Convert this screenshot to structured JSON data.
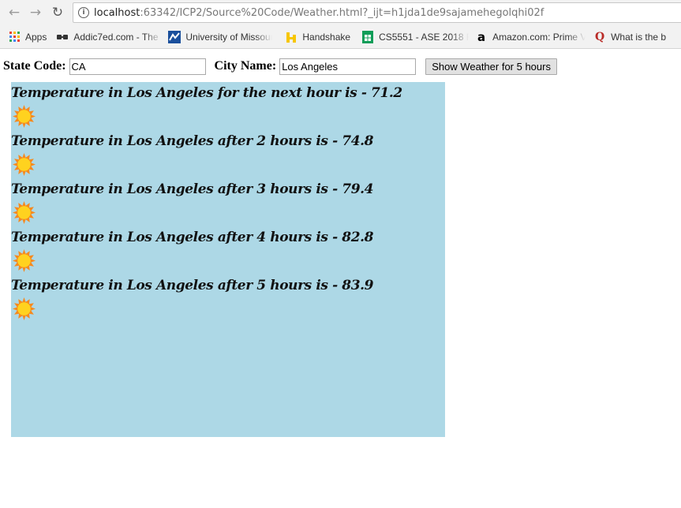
{
  "browser": {
    "url_host": "localhost",
    "url_path": ":63342/ICP2/Source%20Code/Weather.html?_ijt=h1jda1de9sajamehegolqhi02f"
  },
  "bookmarks": [
    {
      "label": "Apps",
      "icon": "apps-grid-icon"
    },
    {
      "label": "Addic7ed.com - The",
      "icon": "addic7ed-icon"
    },
    {
      "label": "University of Missour",
      "icon": "university-icon"
    },
    {
      "label": "Handshake",
      "icon": "handshake-icon"
    },
    {
      "label": "CS5551 - ASE 2018 Fa",
      "icon": "sheets-icon"
    },
    {
      "label": "Amazon.com: Prime V",
      "icon": "amazon-icon"
    },
    {
      "label": "What is the b",
      "icon": "quora-icon"
    }
  ],
  "form": {
    "state_label": "State Code:",
    "state_value": "CA",
    "city_label": "City Name:",
    "city_value": "Los Angeles",
    "button_label": "Show Weather for 5 hours"
  },
  "forecast": [
    {
      "text": "Temperature in Los Angeles for the next hour is - 71.2",
      "icon": "sun-icon"
    },
    {
      "text": "Temperature in Los Angeles after 2 hours is - 74.8",
      "icon": "sun-icon"
    },
    {
      "text": "Temperature in Los Angeles after 3 hours is - 79.4",
      "icon": "sun-icon"
    },
    {
      "text": "Temperature in Los Angeles after 4 hours is - 82.8",
      "icon": "sun-icon"
    },
    {
      "text": "Temperature in Los Angeles after 5 hours is - 83.9",
      "icon": "sun-icon"
    }
  ],
  "colors": {
    "panel_background": "#add8e6",
    "sun_core": "#ffd21f",
    "sun_rays": "#f58a1f"
  }
}
